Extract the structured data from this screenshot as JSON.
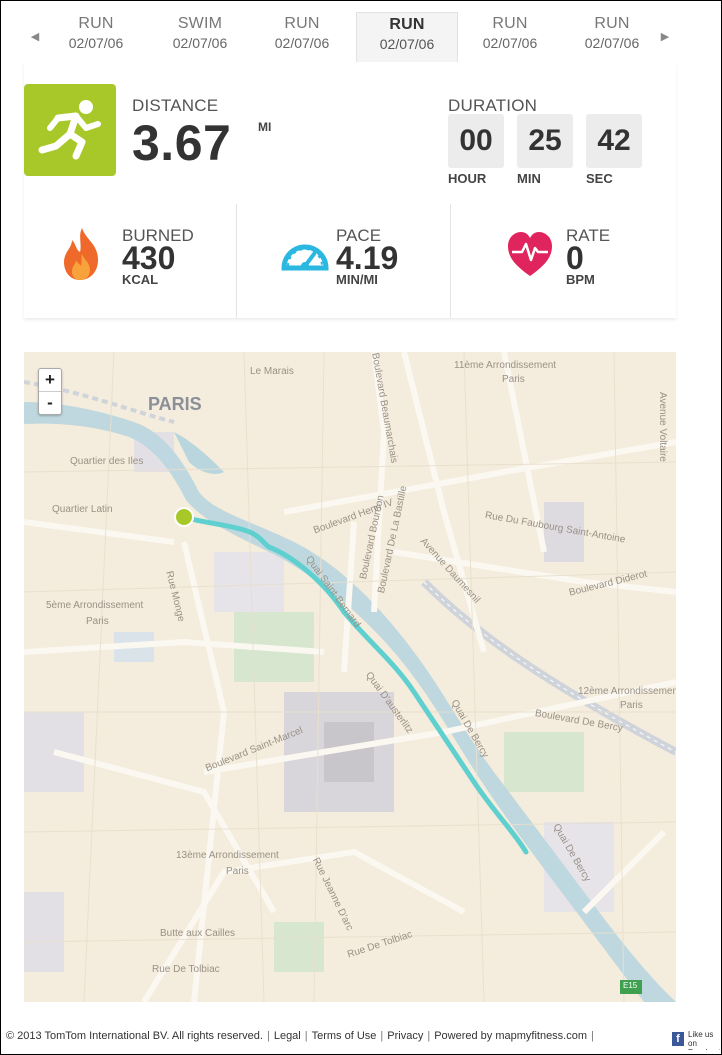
{
  "tabs": [
    {
      "type": "RUN",
      "date": "02/07/06"
    },
    {
      "type": "SWIM",
      "date": "02/07/06"
    },
    {
      "type": "RUN",
      "date": "02/07/06"
    },
    {
      "type": "RUN",
      "date": "02/07/06",
      "active": true
    },
    {
      "type": "RUN",
      "date": "02/07/06"
    },
    {
      "type": "RUN",
      "date": "02/07/06"
    }
  ],
  "nav": {
    "prev_icon": "◀",
    "next_icon": "▶"
  },
  "summary": {
    "distance_label": "DISTANCE",
    "distance_value": "3.67",
    "distance_unit": "MI",
    "duration_label": "DURATION",
    "hours": "00",
    "hours_label": "HOUR",
    "minutes": "25",
    "minutes_label": "MIN",
    "seconds": "42",
    "seconds_label": "SEC"
  },
  "stats": {
    "burned": {
      "label": "BURNED",
      "value": "430",
      "unit": "KCAL"
    },
    "pace": {
      "label": "PACE",
      "value": "4.19",
      "unit": "MIN/MI"
    },
    "rate": {
      "label": "RATE",
      "value": "0",
      "unit": "BPM"
    }
  },
  "map": {
    "zoom_in": "+",
    "zoom_out": "-",
    "labels": {
      "paris": "PARIS",
      "le_marais": "Le Marais",
      "arr11": "11ème Arrondissement",
      "arr11b": "Paris",
      "quartier_des_iles": "Quartier des Iles",
      "quartier_latin": "Quartier Latin",
      "bd_henri": "Boulevard Henri IV",
      "bd_bourdon": "Boulevard Bourdon",
      "bd_bastille": "Boulevard De La Bastille",
      "faubourg": "Rue Du Faubourg Saint-Antoine",
      "daumesnil": "Avenue Daumesnil",
      "diderot": "Boulevard Diderot",
      "arr5": "5ème Arrondissement",
      "arr5b": "Paris",
      "rue_monge": "Rue Monge",
      "quai_st_bernard": "Quai Saint-Bernard",
      "quai_austerlitz": "Quai D'austerlitz",
      "quai_bercy": "Quai De Bercy",
      "quai_bercy2": "Quai De Bercy",
      "arr12": "12ème Arrondissement",
      "arr12b": "Paris",
      "bd_bercy": "Boulevard De Bercy",
      "bd_st_marcel": "Boulevard Saint-Marcel",
      "arr13": "13ème Arrondissement",
      "arr13b": "Paris",
      "jeanne_darc": "Rue Jeanne D'arc",
      "butte": "Butte aux Cailles",
      "tolbiac": "Rue De Tolbiac",
      "tolbiac2": "Rue De Tolbiac",
      "beaumarchais": "Boulevard Beaumarchais",
      "voltaire": "Avenue Voltaire",
      "e15": "E15"
    },
    "colors": {
      "route": "#5fd0cf",
      "start": "#a8c82a",
      "water": "#b9d6df"
    }
  },
  "footer": {
    "copyright": "© 2013 TomTom International BV. All rights reserved.",
    "legal": "Legal",
    "terms": "Terms of Use",
    "privacy": "Privacy",
    "powered": "Powered by  mapmyfitness.com",
    "facebook": "Like us on Facebook",
    "facebook_icon": "f"
  },
  "colors": {
    "accent_green": "#a8c82a",
    "flame": "#ef6a2a",
    "gauge": "#2ab7e0",
    "heart": "#e0245e"
  }
}
